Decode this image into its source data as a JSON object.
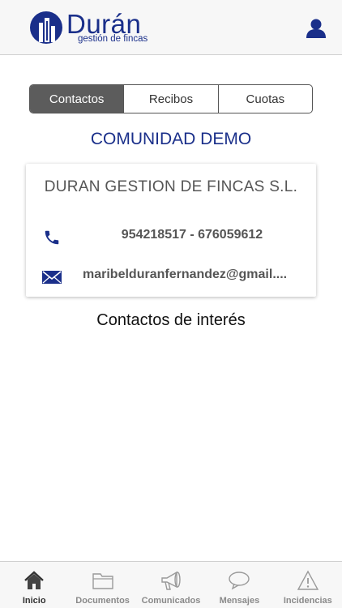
{
  "header": {
    "logo_name": "Durán",
    "logo_tagline": "gestión de fincas",
    "user_icon": "user-icon"
  },
  "segments": {
    "items": [
      {
        "label": "Contactos",
        "active": true
      },
      {
        "label": "Recibos",
        "active": false
      },
      {
        "label": "Cuotas",
        "active": false
      }
    ]
  },
  "community_name": "COMUNIDAD DEMO",
  "contact_card": {
    "company": "DURAN GESTION DE FINCAS S.L.",
    "phone": "954218517 - 676059612",
    "email": "maribelduranfernandez@gmail...."
  },
  "interest_link": "Contactos de interés",
  "tabbar": {
    "items": [
      {
        "label": "Inicio",
        "icon": "home-icon",
        "active": true
      },
      {
        "label": "Documentos",
        "icon": "folder-icon",
        "active": false
      },
      {
        "label": "Comunicados",
        "icon": "megaphone-icon",
        "active": false
      },
      {
        "label": "Mensajes",
        "icon": "chat-bubble-icon",
        "active": false
      },
      {
        "label": "Incidencias",
        "icon": "warning-icon",
        "active": false
      }
    ]
  },
  "colors": {
    "brand_blue": "#1a2f8a",
    "segment_active": "#5c5c5c"
  }
}
